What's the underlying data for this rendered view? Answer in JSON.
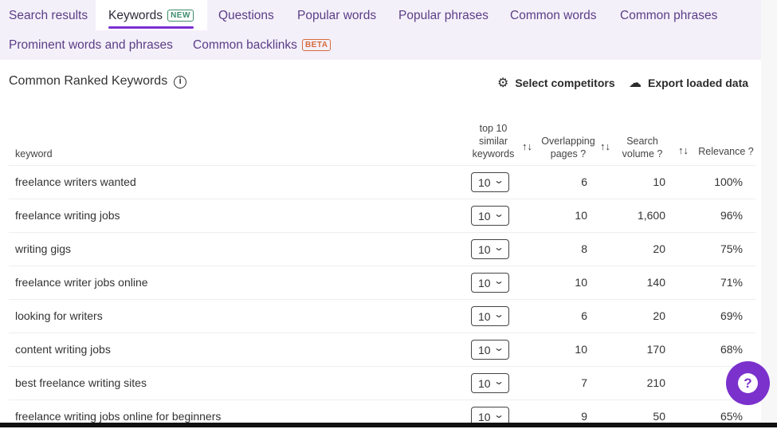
{
  "tabs": [
    {
      "label": "Search results"
    },
    {
      "label": "Keywords",
      "badge": "NEW",
      "active": true
    },
    {
      "label": "Questions"
    },
    {
      "label": "Popular words"
    },
    {
      "label": "Popular phrases"
    },
    {
      "label": "Common words"
    },
    {
      "label": "Common phrases"
    },
    {
      "label": "Prominent words and phrases"
    },
    {
      "label": "Common backlinks",
      "badge": "BETA"
    }
  ],
  "section": {
    "title": "Common Ranked Keywords",
    "info_icon": "i",
    "select_competitors": "Select competitors",
    "export": "Export loaded data"
  },
  "columns": {
    "keyword": "keyword",
    "similar": "top 10 similar keywords",
    "overlapping": "Overlapping pages ?",
    "volume": "Search volume ?",
    "relevance": "Relevance ?",
    "sort_icon": "↑↓"
  },
  "rows": [
    {
      "keyword": "freelance writers wanted",
      "similar": "10",
      "overlapping": "6",
      "volume": "10",
      "relevance": "100%"
    },
    {
      "keyword": "freelance writing jobs",
      "similar": "10",
      "overlapping": "10",
      "volume": "1,600",
      "relevance": "96%"
    },
    {
      "keyword": "writing gigs",
      "similar": "10",
      "overlapping": "8",
      "volume": "20",
      "relevance": "75%"
    },
    {
      "keyword": "freelance writer jobs online",
      "similar": "10",
      "overlapping": "10",
      "volume": "140",
      "relevance": "71%"
    },
    {
      "keyword": "looking for writers",
      "similar": "10",
      "overlapping": "6",
      "volume": "20",
      "relevance": "69%"
    },
    {
      "keyword": "content writing jobs",
      "similar": "10",
      "overlapping": "10",
      "volume": "170",
      "relevance": "68%"
    },
    {
      "keyword": "best freelance writing sites",
      "similar": "10",
      "overlapping": "7",
      "volume": "210",
      "relevance": "6"
    },
    {
      "keyword": "freelance writing jobs online for beginners",
      "similar": "10",
      "overlapping": "9",
      "volume": "50",
      "relevance": "65%"
    }
  ],
  "help_button": "?"
}
